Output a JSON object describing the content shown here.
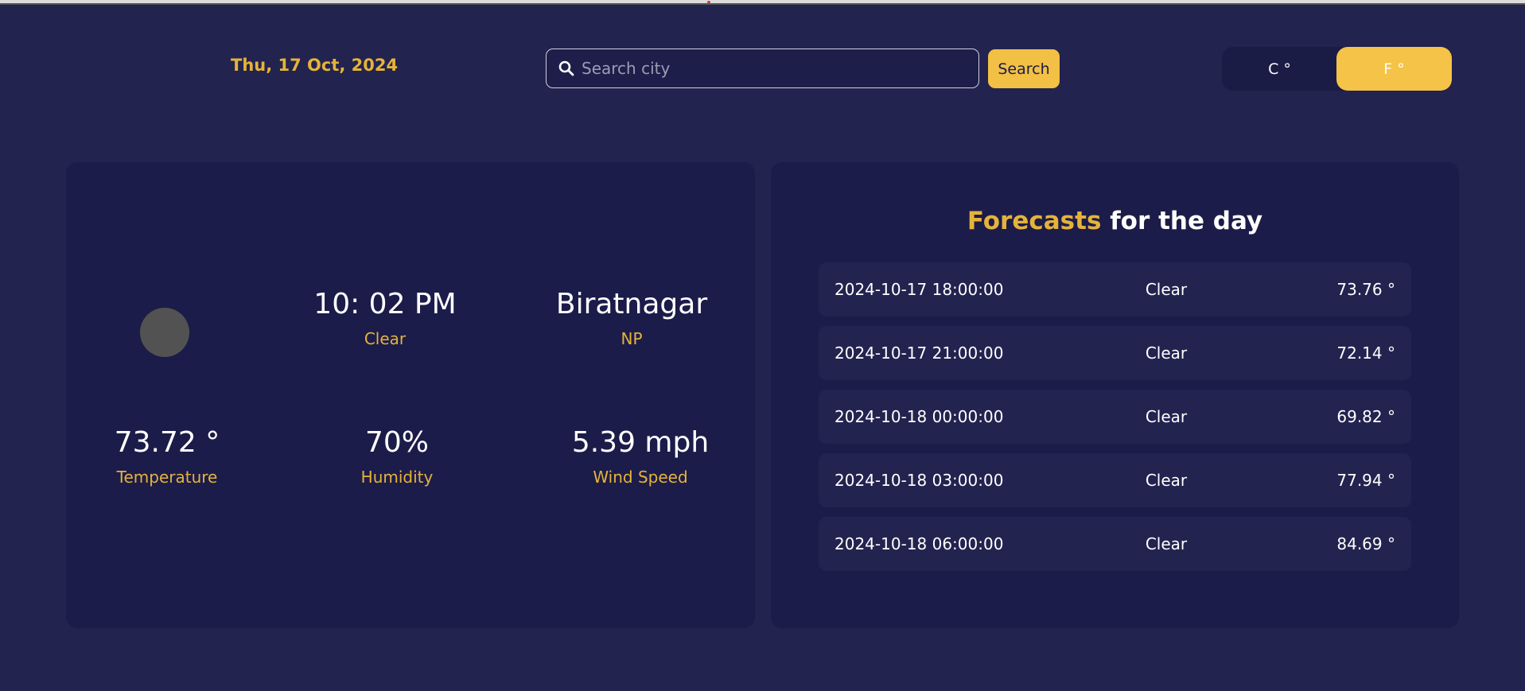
{
  "header": {
    "date": "Thu, 17 Oct, 2024",
    "search": {
      "placeholder": "Search city",
      "value": "",
      "icon": "search-icon"
    },
    "search_button_label": "Search",
    "units": {
      "celsius_label": "C °",
      "fahrenheit_label": "F °",
      "selected": "F °"
    }
  },
  "current": {
    "icon": "weather-icon",
    "time": "10: 02 PM",
    "condition": "Clear",
    "city": "Biratnagar",
    "country": "NP",
    "temperature_value": "73.72 °",
    "temperature_label": "Temperature",
    "humidity_value": "70%",
    "humidity_label": "Humidity",
    "wind_value": "5.39 mph",
    "wind_label": "Wind Speed"
  },
  "forecast": {
    "title_accent": "Forecasts",
    "title_rest": " for the day",
    "items": [
      {
        "datetime": "2024-10-17 18:00:00",
        "condition": "Clear",
        "temp": "73.76 °"
      },
      {
        "datetime": "2024-10-17 21:00:00",
        "condition": "Clear",
        "temp": "72.14 °"
      },
      {
        "datetime": "2024-10-18 00:00:00",
        "condition": "Clear",
        "temp": "69.82 °"
      },
      {
        "datetime": "2024-10-18 03:00:00",
        "condition": "Clear",
        "temp": "77.94 °"
      },
      {
        "datetime": "2024-10-18 06:00:00",
        "condition": "Clear",
        "temp": "84.69 °"
      }
    ]
  },
  "colors": {
    "background": "#22234f",
    "panel": "#1c1c4a",
    "accent": "#e5b33a",
    "button": "#f2c044",
    "text": "#ffffff"
  }
}
